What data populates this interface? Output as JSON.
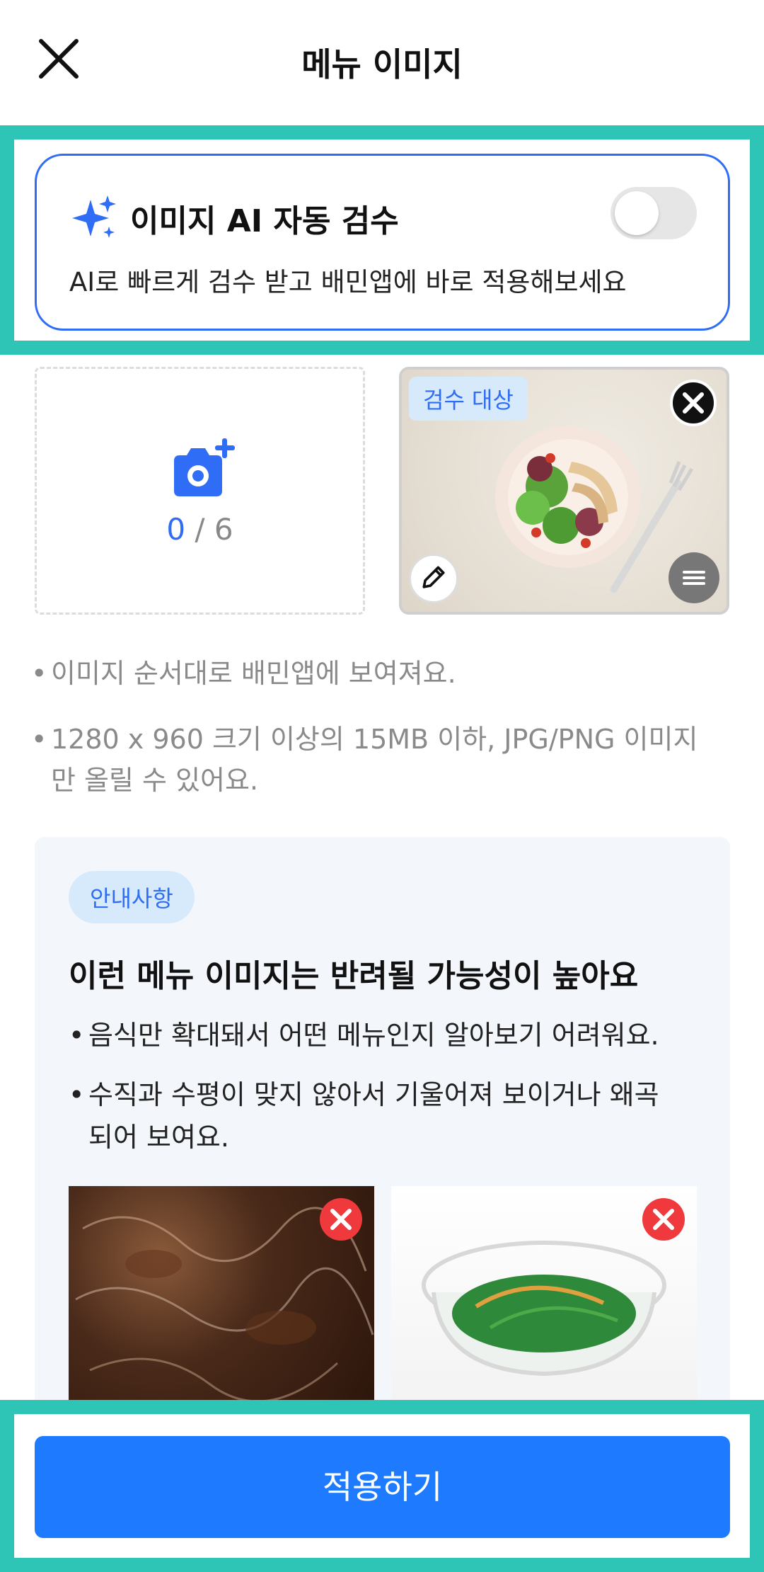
{
  "header": {
    "title": "메뉴 이미지",
    "close_icon": "close-icon"
  },
  "ai_review": {
    "title": "이미지 AI 자동 검수",
    "description": "AI로 빠르게 검수 받고 배민앱에 바로 적용해보세요",
    "toggle_on": false,
    "icon": "sparkle-icon"
  },
  "upload": {
    "current": "0",
    "separator": "/ 6",
    "icon": "camera-add-icon"
  },
  "image_card": {
    "badge": "검수 대상"
  },
  "notes": [
    "이미지 순서대로 배민앱에 보여져요.",
    "1280 x 960 크기 이상의 15MB 이하, JPG/PNG 이미지",
    "만 올릴 수 있어요."
  ],
  "guide": {
    "badge": "안내사항",
    "title": "이런 메뉴 이미지는 반려될 가능성이 높아요",
    "items": [
      "음식만 확대돼서 어떤 메뉴인지 알아보기 어려워요.",
      "수직과 수평이 맞지 않아서 기울어져 보이거나 왜곡",
      "되어 보여요."
    ]
  },
  "cta": {
    "label": "적용하기"
  },
  "colors": {
    "accent": "#1e7bff",
    "highlight": "#2ec4b6",
    "error": "#ff3b3b"
  }
}
